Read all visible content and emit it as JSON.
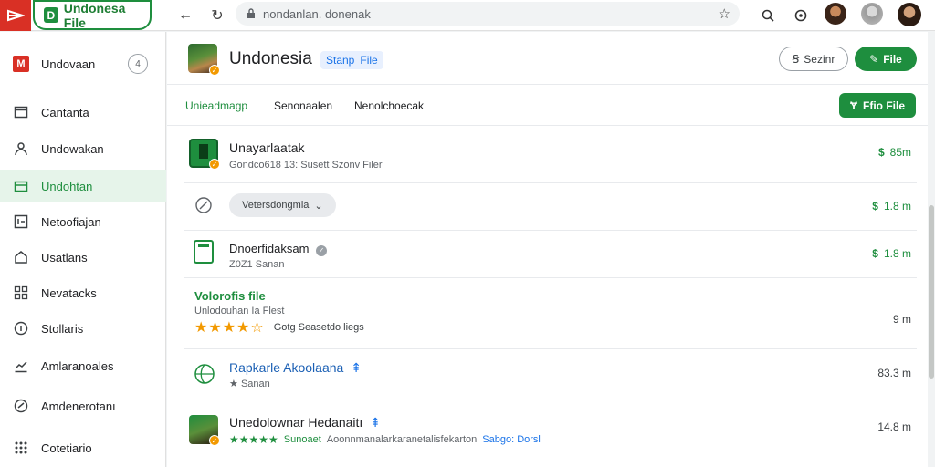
{
  "browser": {
    "tab_title": "Undonesa File",
    "tab_badge": "D",
    "url": "nondanlan. donenak"
  },
  "sidebar": {
    "header_label": "Undovaan",
    "header_badge": "4",
    "items": [
      {
        "label": "Cantanta",
        "icon": "folder-icon",
        "active": false
      },
      {
        "label": "Undowakan",
        "icon": "user-icon",
        "active": false
      },
      {
        "label": "Undohtan",
        "icon": "download-icon",
        "active": true
      },
      {
        "label": "Netoofiajan",
        "icon": "list-icon",
        "active": false
      },
      {
        "label": "Usatlans",
        "icon": "home-icon",
        "active": false
      },
      {
        "label": "Nevatacks",
        "icon": "grid-icon",
        "active": false
      },
      {
        "label": "Stollaris",
        "icon": "info-icon",
        "active": false
      },
      {
        "label": "Amlaranoales",
        "icon": "chart-icon",
        "active": false
      },
      {
        "label": "Amdenerotanı",
        "icon": "send-icon",
        "active": false
      },
      {
        "label": "Cotetiario",
        "icon": "apps-icon",
        "active": false
      }
    ]
  },
  "header": {
    "title": "Undonesia",
    "chip_a": "Stanp",
    "chip_b": "File",
    "outline_button": "Sezinr",
    "outline_icon": "Ꞩ",
    "green_button": "File",
    "green_icon": "✎"
  },
  "subnav": {
    "tabs": [
      "Unieadmagp",
      "Senonaalen",
      "Nenolchoecak"
    ],
    "action_button": "Ffio File",
    "action_icon": "Ɏ"
  },
  "rows": [
    {
      "title": "Unayarlaatak",
      "subtitle": "Gondco618 13: Susett Szonv Filer",
      "size": "85m",
      "size_icon": "$"
    },
    {
      "pill": "Vetersdongmia",
      "size": "1.8 m",
      "size_icon": "$"
    },
    {
      "title": "Dnoerfidaksam",
      "subtitle": "Z0Z1 Sanan",
      "size": "1.8 m",
      "size_icon": "$"
    },
    {
      "title": "Volorofis file",
      "subtitle": "Unlodouhan Ia Flest",
      "rating_text": "Gotg Seasetdo liegs",
      "size": "9 m"
    },
    {
      "title": "Rapkarle Akoolaana",
      "subtitle": "Sanan",
      "size": "83.3 m"
    },
    {
      "title": "Unedolownar Hedanaitı",
      "subtitle_a": "Sunoaet",
      "subtitle_b": "Aoonnmanalarkaranetalisfekarton",
      "subtitle_c": "Sabgo: Dorsl",
      "size": "14.8 m"
    }
  ],
  "colors": {
    "brand_red": "#d93025",
    "accent_green": "#1e8e3e",
    "link_blue": "#1a73e8",
    "star_orange": "#f29900"
  }
}
